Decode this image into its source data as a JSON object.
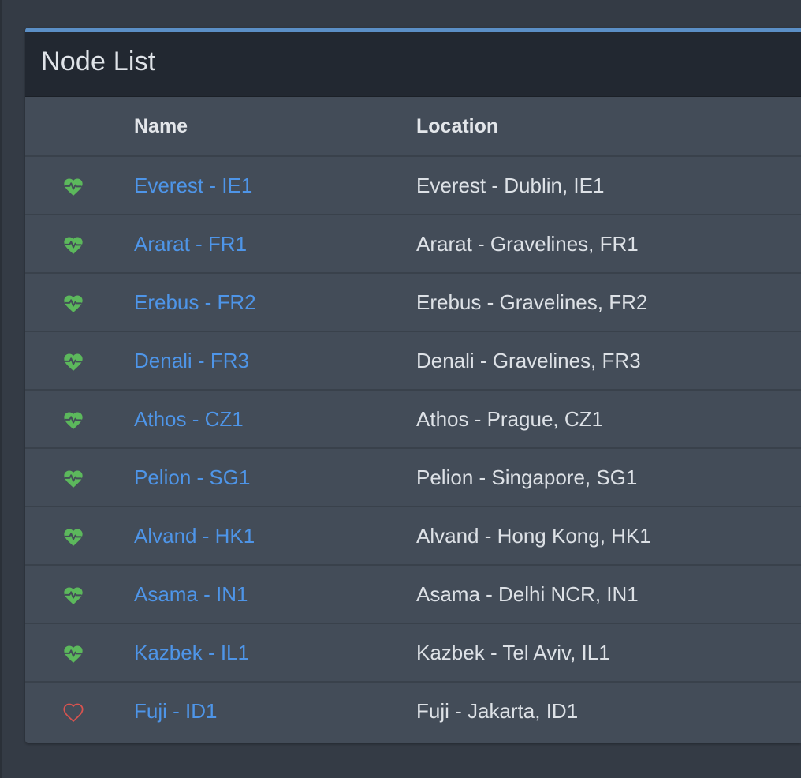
{
  "panel": {
    "title": "Node List",
    "accent_color": "#5b8fc6"
  },
  "table": {
    "columns": [
      "",
      "Name",
      "Location"
    ],
    "rows": [
      {
        "status": "healthy",
        "status_icon": "heartbeat-icon",
        "name": "Everest - IE1",
        "location": "Everest - Dublin, IE1"
      },
      {
        "status": "healthy",
        "status_icon": "heartbeat-icon",
        "name": "Ararat - FR1",
        "location": "Ararat - Gravelines, FR1"
      },
      {
        "status": "healthy",
        "status_icon": "heartbeat-icon",
        "name": "Erebus - FR2",
        "location": "Erebus - Gravelines, FR2"
      },
      {
        "status": "healthy",
        "status_icon": "heartbeat-icon",
        "name": "Denali - FR3",
        "location": "Denali - Gravelines, FR3"
      },
      {
        "status": "healthy",
        "status_icon": "heartbeat-icon",
        "name": "Athos - CZ1",
        "location": "Athos - Prague, CZ1"
      },
      {
        "status": "healthy",
        "status_icon": "heartbeat-icon",
        "name": "Pelion - SG1",
        "location": "Pelion - Singapore, SG1"
      },
      {
        "status": "healthy",
        "status_icon": "heartbeat-icon",
        "name": "Alvand - HK1",
        "location": "Alvand - Hong Kong, HK1"
      },
      {
        "status": "healthy",
        "status_icon": "heartbeat-icon",
        "name": "Asama - IN1",
        "location": "Asama - Delhi NCR, IN1"
      },
      {
        "status": "healthy",
        "status_icon": "heartbeat-icon",
        "name": "Kazbek - IL1",
        "location": "Kazbek - Tel Aviv, IL1"
      },
      {
        "status": "offline",
        "status_icon": "heart-outline-icon",
        "name": "Fuji - ID1",
        "location": "Fuji - Jakarta, ID1"
      }
    ]
  },
  "colors": {
    "healthy": "#5cb85c",
    "offline": "#d9534f",
    "link": "#4e95e8"
  }
}
